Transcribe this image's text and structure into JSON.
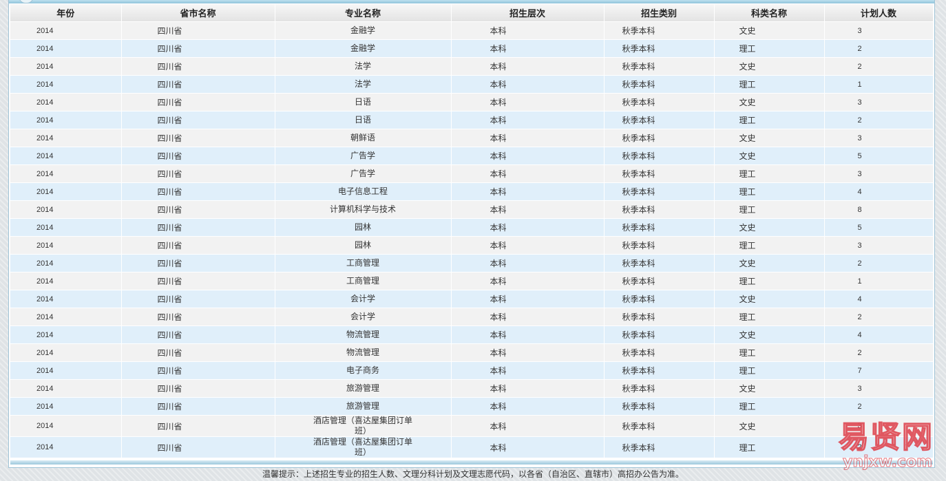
{
  "table": {
    "headers": [
      "年份",
      "省市名称",
      "专业名称",
      "招生层次",
      "招生类别",
      "科类名称",
      "计划人数"
    ],
    "rows": [
      {
        "year": "2014",
        "province": "四川省",
        "major": "金融学",
        "level": "本科",
        "category": "秋季本科",
        "subject": "文史",
        "plan": "3"
      },
      {
        "year": "2014",
        "province": "四川省",
        "major": "金融学",
        "level": "本科",
        "category": "秋季本科",
        "subject": "理工",
        "plan": "2"
      },
      {
        "year": "2014",
        "province": "四川省",
        "major": "法学",
        "level": "本科",
        "category": "秋季本科",
        "subject": "文史",
        "plan": "2"
      },
      {
        "year": "2014",
        "province": "四川省",
        "major": "法学",
        "level": "本科",
        "category": "秋季本科",
        "subject": "理工",
        "plan": "1"
      },
      {
        "year": "2014",
        "province": "四川省",
        "major": "日语",
        "level": "本科",
        "category": "秋季本科",
        "subject": "文史",
        "plan": "3"
      },
      {
        "year": "2014",
        "province": "四川省",
        "major": "日语",
        "level": "本科",
        "category": "秋季本科",
        "subject": "理工",
        "plan": "2"
      },
      {
        "year": "2014",
        "province": "四川省",
        "major": "朝鲜语",
        "level": "本科",
        "category": "秋季本科",
        "subject": "文史",
        "plan": "3"
      },
      {
        "year": "2014",
        "province": "四川省",
        "major": "广告学",
        "level": "本科",
        "category": "秋季本科",
        "subject": "文史",
        "plan": "5"
      },
      {
        "year": "2014",
        "province": "四川省",
        "major": "广告学",
        "level": "本科",
        "category": "秋季本科",
        "subject": "理工",
        "plan": "3"
      },
      {
        "year": "2014",
        "province": "四川省",
        "major": "电子信息工程",
        "level": "本科",
        "category": "秋季本科",
        "subject": "理工",
        "plan": "4"
      },
      {
        "year": "2014",
        "province": "四川省",
        "major": "计算机科学与技术",
        "level": "本科",
        "category": "秋季本科",
        "subject": "理工",
        "plan": "8"
      },
      {
        "year": "2014",
        "province": "四川省",
        "major": "园林",
        "level": "本科",
        "category": "秋季本科",
        "subject": "文史",
        "plan": "5"
      },
      {
        "year": "2014",
        "province": "四川省",
        "major": "园林",
        "level": "本科",
        "category": "秋季本科",
        "subject": "理工",
        "plan": "3"
      },
      {
        "year": "2014",
        "province": "四川省",
        "major": "工商管理",
        "level": "本科",
        "category": "秋季本科",
        "subject": "文史",
        "plan": "2"
      },
      {
        "year": "2014",
        "province": "四川省",
        "major": "工商管理",
        "level": "本科",
        "category": "秋季本科",
        "subject": "理工",
        "plan": "1"
      },
      {
        "year": "2014",
        "province": "四川省",
        "major": "会计学",
        "level": "本科",
        "category": "秋季本科",
        "subject": "文史",
        "plan": "4"
      },
      {
        "year": "2014",
        "province": "四川省",
        "major": "会计学",
        "level": "本科",
        "category": "秋季本科",
        "subject": "理工",
        "plan": "2"
      },
      {
        "year": "2014",
        "province": "四川省",
        "major": "物流管理",
        "level": "本科",
        "category": "秋季本科",
        "subject": "文史",
        "plan": "4"
      },
      {
        "year": "2014",
        "province": "四川省",
        "major": "物流管理",
        "level": "本科",
        "category": "秋季本科",
        "subject": "理工",
        "plan": "2"
      },
      {
        "year": "2014",
        "province": "四川省",
        "major": "电子商务",
        "level": "本科",
        "category": "秋季本科",
        "subject": "理工",
        "plan": "7"
      },
      {
        "year": "2014",
        "province": "四川省",
        "major": "旅游管理",
        "level": "本科",
        "category": "秋季本科",
        "subject": "文史",
        "plan": "3"
      },
      {
        "year": "2014",
        "province": "四川省",
        "major": "旅游管理",
        "level": "本科",
        "category": "秋季本科",
        "subject": "理工",
        "plan": "2"
      },
      {
        "year": "2014",
        "province": "四川省",
        "major": "酒店管理（喜达屋集团订单班）",
        "level": "本科",
        "category": "秋季本科",
        "subject": "文史",
        "plan": "3"
      },
      {
        "year": "2014",
        "province": "四川省",
        "major": "酒店管理（喜达屋集团订单班）",
        "level": "本科",
        "category": "秋季本科",
        "subject": "理工",
        "plan": "2"
      }
    ]
  },
  "footer": {
    "tip": "温馨提示：上述招生专业的招生人数、文理分科计划及文理志愿代码，以各省（自治区、直辖市）高招办公告为准。"
  },
  "watermark": {
    "main": "易贤网",
    "sub": "ynjxw.com"
  },
  "colors": {
    "row_odd": "#f2f2f2",
    "row_even": "#e0effa",
    "header_bg": "#e8e8e8",
    "panel_border": "#9fc3d6",
    "watermark": "#dc3c46"
  }
}
